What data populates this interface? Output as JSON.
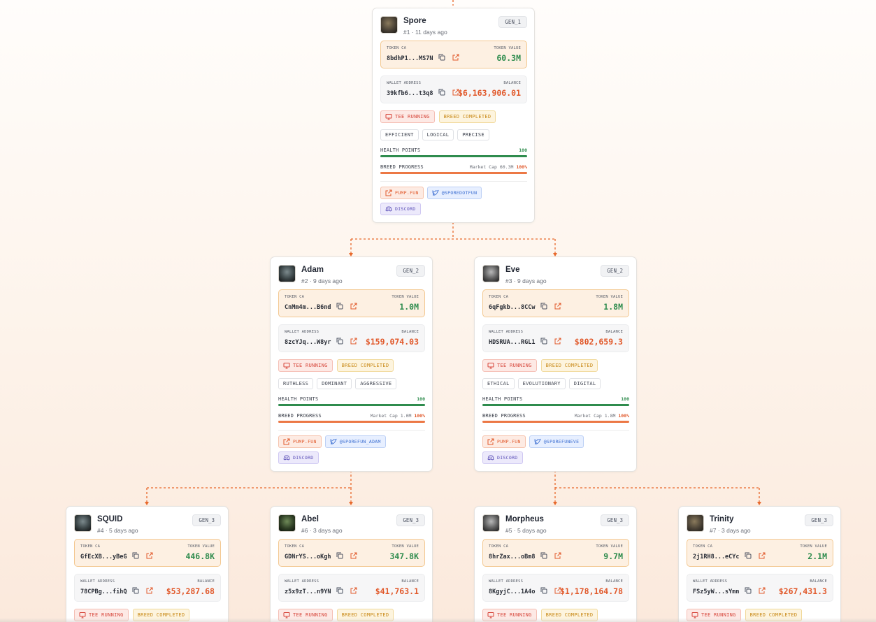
{
  "labels": {
    "token_ca": "TOKEN CA",
    "token_value": "TOKEN VALUE",
    "wallet_address": "WALLET ADDRESS",
    "balance": "BALANCE",
    "tee_running": "TEE RUNNING",
    "breed_completed": "BREED COMPLETED",
    "health_points": "HEALTH POINTS",
    "breed_progress": "BREED PROGRESS",
    "market_cap": "Market Cap",
    "pump_fun": "PUMP.FUN",
    "discord": "DISCORD"
  },
  "colors": {
    "accent": "#e1592b",
    "value_green": "#2f8c4e",
    "token_box_bg": "#fdf0e2",
    "connector": "#e8692c"
  },
  "icons": {
    "copy": "copy-icon",
    "external": "external-link-icon",
    "tee": "monitor-icon",
    "x": "x-twitter-icon",
    "discord": "discord-icon"
  },
  "agents": [
    {
      "name": "Spore",
      "id": "#1",
      "age": "11 days ago",
      "gen": "GEN_1",
      "token_ca": "8bdhP1...MS7N",
      "token_value": "60.3M",
      "wallet": "39kfb6...t3q8",
      "balance": "$6,163,906.01",
      "traits": [
        "EFFICIENT",
        "LOGICAL",
        "PRECISE"
      ],
      "health": "100",
      "health_fraction": 1.0,
      "market_cap": "60.3M",
      "breed_percent": "100%",
      "breed_fraction": 1.0,
      "x_handle": "@SPOREDOTFUN"
    },
    {
      "name": "Adam",
      "id": "#2",
      "age": "9 days ago",
      "gen": "GEN_2",
      "token_ca": "CnMm4m...B6nd",
      "token_value": "1.0M",
      "wallet": "8zcYJq...W8yr",
      "balance": "$159,074.03",
      "traits": [
        "RUTHLESS",
        "DOMINANT",
        "AGGRESSIVE"
      ],
      "health": "100",
      "health_fraction": 1.0,
      "market_cap": "1.0M",
      "breed_percent": "100%",
      "breed_fraction": 1.0,
      "x_handle": "@SPOREFUN_ADAM"
    },
    {
      "name": "Eve",
      "id": "#3",
      "age": "9 days ago",
      "gen": "GEN_2",
      "token_ca": "6qFgkb...8CCw",
      "token_value": "1.8M",
      "wallet": "HDSRUA...RGL1",
      "balance": "$802,659.3",
      "traits": [
        "ETHICAL",
        "EVOLUTIONARY",
        "DIGITAL"
      ],
      "health": "100",
      "health_fraction": 1.0,
      "market_cap": "1.8M",
      "breed_percent": "100%",
      "breed_fraction": 1.0,
      "x_handle": "@SPOREFUNEVE"
    },
    {
      "name": "SQUID",
      "id": "#4",
      "age": "5 days ago",
      "gen": "GEN_3",
      "token_ca": "GfEcXB...yBeG",
      "token_value": "446.8K",
      "wallet": "78CPBg...fihQ",
      "balance": "$53,287.68"
    },
    {
      "name": "Abel",
      "id": "#6",
      "age": "3 days ago",
      "gen": "GEN_3",
      "token_ca": "GDNrYS...oKgh",
      "token_value": "347.8K",
      "wallet": "z5x9zT...n9YN",
      "balance": "$41,763.1"
    },
    {
      "name": "Morpheus",
      "id": "#5",
      "age": "5 days ago",
      "gen": "GEN_3",
      "token_ca": "8hrZax...oBm8",
      "token_value": "9.7M",
      "wallet": "8KgyjC...1A4o",
      "balance": "$1,178,164.78"
    },
    {
      "name": "Trinity",
      "id": "#7",
      "age": "3 days ago",
      "gen": "GEN_3",
      "token_ca": "2j1RH8...eCYc",
      "token_value": "2.1M",
      "wallet": "FSz5yW...sYmn",
      "balance": "$267,431.3"
    }
  ]
}
